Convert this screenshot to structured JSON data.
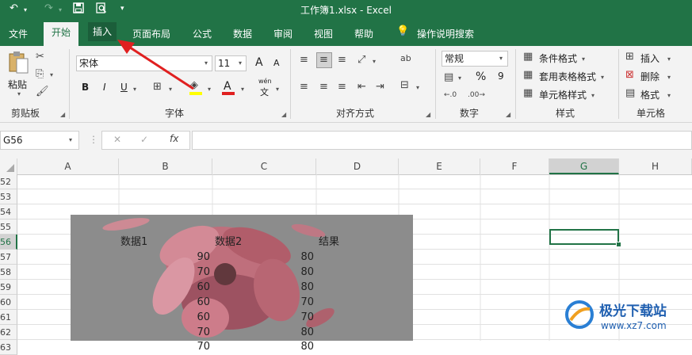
{
  "window": {
    "title": "工作簿1.xlsx  -  Excel",
    "quick_access": {
      "undo": "↶",
      "redo": "↷",
      "save": "💾",
      "preview": "🔍",
      "more": "▾"
    }
  },
  "tabs": [
    {
      "label": "文件"
    },
    {
      "label": "开始"
    },
    {
      "label": "插入"
    },
    {
      "label": "页面布局"
    },
    {
      "label": "公式"
    },
    {
      "label": "数据"
    },
    {
      "label": "审阅"
    },
    {
      "label": "视图"
    },
    {
      "label": "帮助"
    },
    {
      "label": "操作说明搜索"
    }
  ],
  "ribbon": {
    "clipboard": {
      "paste": "粘贴",
      "label": "剪贴板"
    },
    "font": {
      "name": "宋体",
      "size": "11",
      "label": "字体",
      "bold": "B",
      "italic": "I",
      "underline": "U",
      "grow": "A",
      "shrink": "A",
      "wen": "wén",
      "wen_char": "文"
    },
    "alignment": {
      "label": "对齐方式"
    },
    "number": {
      "format": "常规",
      "label": "数字",
      "percent": "%",
      "comma": "9"
    },
    "styles": {
      "conditional": "条件格式",
      "table": "套用表格格式",
      "cell": "单元格样式",
      "label": "样式"
    },
    "cells": {
      "insert": "插入",
      "delete": "删除",
      "format": "格式",
      "label": "单元格"
    }
  },
  "formula_bar": {
    "name_box": "G56",
    "cancel": "✕",
    "enter": "✓",
    "fx": "fx",
    "value": ""
  },
  "sheet": {
    "columns": [
      "A",
      "B",
      "C",
      "D",
      "E",
      "F",
      "G",
      "H"
    ],
    "selected_column": "G",
    "selected_row": "56",
    "rows": [
      "52",
      "53",
      "54",
      "55",
      "56",
      "57",
      "58",
      "59",
      "60",
      "61",
      "62",
      "63"
    ],
    "headers": {
      "b": "数据1",
      "c": "数据2",
      "d": "结果"
    },
    "data": [
      {
        "row": "57",
        "b": "90",
        "c": "80"
      },
      {
        "row": "58",
        "b": "70",
        "c": "80"
      },
      {
        "row": "59",
        "b": "60",
        "c": "80"
      },
      {
        "row": "60",
        "b": "60",
        "c": "70"
      },
      {
        "row": "61",
        "b": "60",
        "c": "70"
      },
      {
        "row": "62",
        "b": "70",
        "c": "80"
      },
      {
        "row": "63",
        "b": "70",
        "c": "80"
      }
    ]
  },
  "watermark": {
    "text": "极光下载站",
    "url": "www.xz7.com"
  },
  "colors": {
    "accent": "#217346",
    "arrow": "#e02020"
  }
}
